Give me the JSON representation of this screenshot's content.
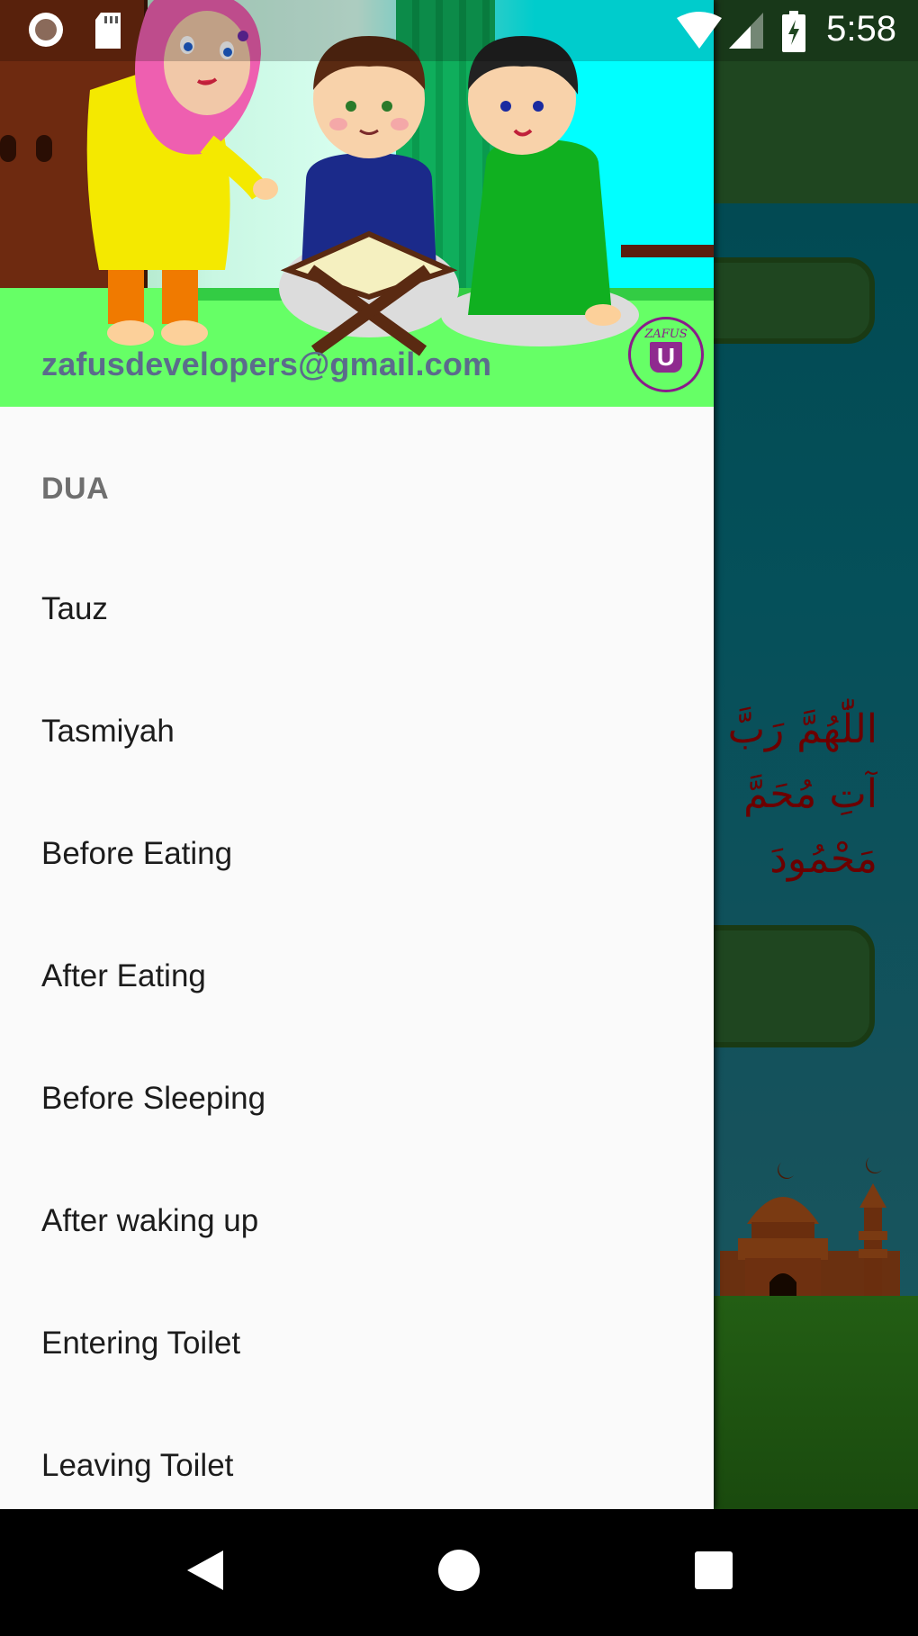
{
  "status_bar": {
    "time": "5:58",
    "icons": [
      "record-icon",
      "sd-card-icon",
      "wifi-icon",
      "signal-icon",
      "battery-charging-icon"
    ]
  },
  "drawer": {
    "header": {
      "email": "zafusdevelopers@gmail.com",
      "logo_top_text": "ZAFUS",
      "logo_letter": "U"
    },
    "section_title": "DUA",
    "items": [
      {
        "label": "Tauz"
      },
      {
        "label": "Tasmiyah"
      },
      {
        "label": "Before Eating"
      },
      {
        "label": "After Eating"
      },
      {
        "label": "Before Sleeping"
      },
      {
        "label": "After waking up"
      },
      {
        "label": "Entering Toilet"
      },
      {
        "label": "Leaving Toilet"
      }
    ]
  },
  "background_app": {
    "arabic_lines": [
      "اللّٰهُمَّ رَبَّ",
      "آتِ مُحَمَّ",
      "مَحْمُودَ"
    ]
  },
  "colors": {
    "header_green": "#66ff66",
    "email_color": "#5b6b8c",
    "logo_purple": "#8a1b8a",
    "toolbar_green": "#1f4620",
    "arabic_red": "#6b0000"
  },
  "nav_bar": {
    "buttons": [
      "back",
      "home",
      "recents"
    ]
  }
}
